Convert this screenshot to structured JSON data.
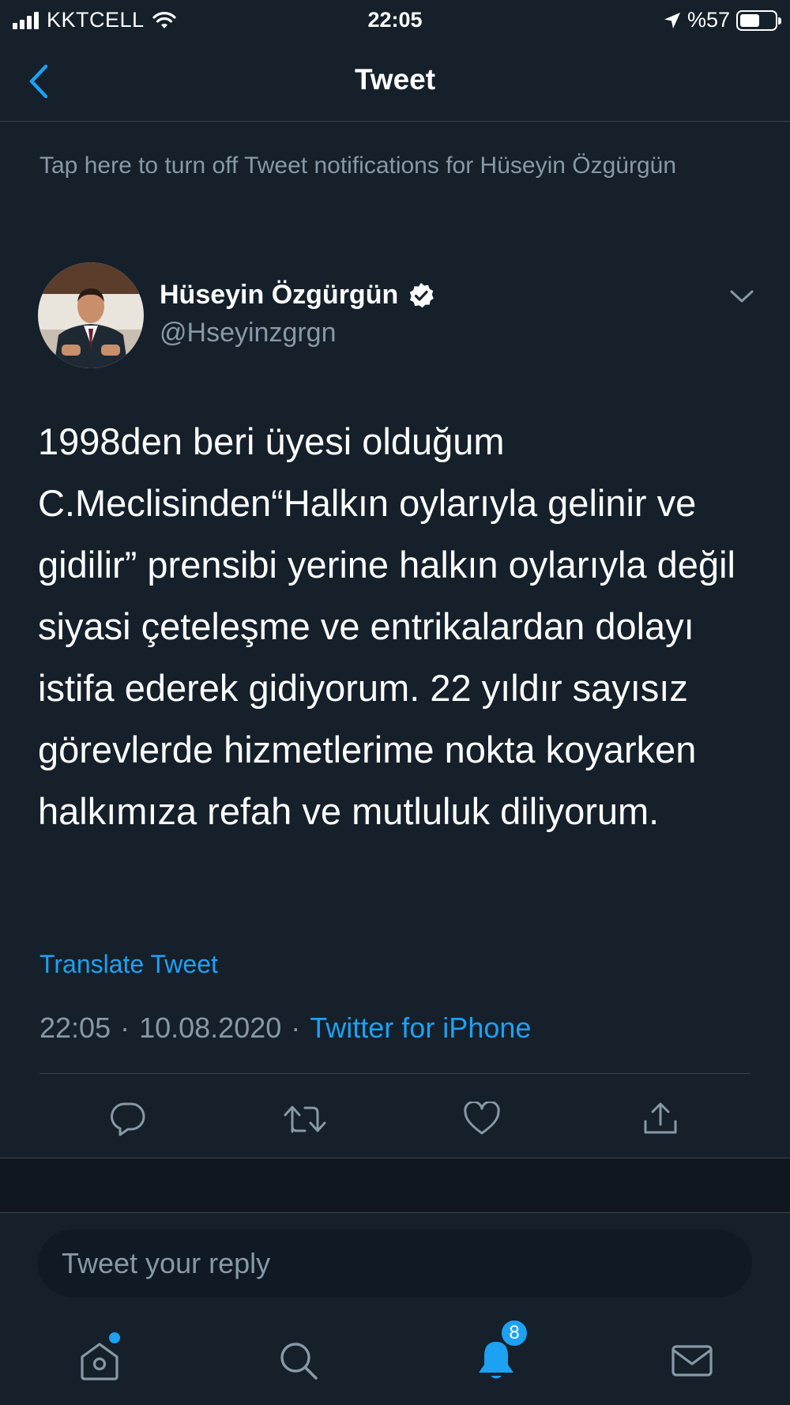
{
  "status_bar": {
    "carrier": "KKTCELL",
    "time": "22:05",
    "battery": "%57",
    "battery_level": 0.57
  },
  "nav": {
    "title": "Tweet",
    "back_icon": "chevron-left-icon"
  },
  "notification_banner": "Tap here to turn off Tweet notifications for Hüseyin Özgürgün",
  "author": {
    "name": "Hüseyin Özgürgün",
    "handle": "@Hseyinzgrgn",
    "verified": true
  },
  "tweet": {
    "text": "1998den beri üyesi olduğum C.Meclisinden“Halkın oylarıyla gelinir ve gidilir” prensibi yerine halkın oylarıyla değil siyasi çeteleşme ve entrikalardan dolayı istifa ederek gidiyorum. 22 yıldır sayısız görevlerde hizmetlerime nokta koyarken halkımıza refah ve mutluluk diliyorum.",
    "translate_label": "Translate Tweet",
    "time": "22:05",
    "date": "10.08.2020",
    "separator": "·",
    "source": "Twitter for iPhone"
  },
  "actions": [
    "reply-icon",
    "retweet-icon",
    "like-icon",
    "share-icon"
  ],
  "reply": {
    "placeholder": "Tweet your reply"
  },
  "tabbar": {
    "notifications_badge": "8",
    "tabs": [
      "home-icon",
      "search-icon",
      "notifications-icon",
      "messages-icon"
    ]
  },
  "colors": {
    "background": "#15202b",
    "accent": "#1da1f2",
    "secondary_text": "#8899a6",
    "divider": "#38444d"
  }
}
